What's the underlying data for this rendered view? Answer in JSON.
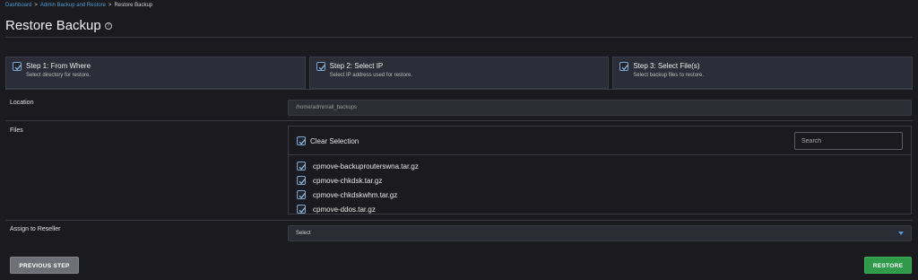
{
  "breadcrumb": {
    "items": [
      "Dashboard",
      "Admin Backup and Restore"
    ],
    "separator": ">",
    "current": "Restore Backup"
  },
  "page": {
    "title": "Restore Backup",
    "help_glyph": "?"
  },
  "steps": [
    {
      "title": "Step 1: From Where",
      "desc": "Select directory for restore.",
      "checked": true
    },
    {
      "title": "Step 2: Select IP",
      "desc": "Select IP address used for restore.",
      "checked": true
    },
    {
      "title": "Step 3: Select File(s)",
      "desc": "Select backup files to restore.",
      "checked": true
    }
  ],
  "location": {
    "label": "Location",
    "value": "/home/admin/all_backups"
  },
  "files": {
    "label": "Files",
    "clear_label": "Clear Selection",
    "search_placeholder": "Search",
    "items": [
      "cpmove-backuprouterswna.tar.gz",
      "cpmove-chkdsk.tar.gz",
      "cpmove-chkdskwhm.tar.gz",
      "cpmove-ddos.tar.gz"
    ]
  },
  "reseller": {
    "label": "Assign to Reseller",
    "selected": "Select"
  },
  "buttons": {
    "previous": "PREVIOUS STEP",
    "restore": "RESTORE"
  },
  "colors": {
    "link": "#4e9bd6",
    "restore_button": "#2f9a4a",
    "previous_button": "#6f7075",
    "check": "#7aa7d6"
  }
}
